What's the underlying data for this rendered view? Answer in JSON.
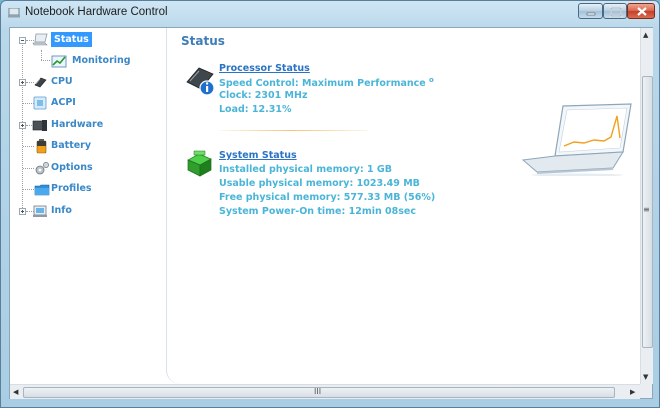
{
  "window": {
    "title": "Notebook Hardware Control",
    "controls": [
      "minimize",
      "maximize",
      "close"
    ]
  },
  "tree": {
    "items": [
      {
        "label": "Status",
        "icon": "notebook-icon",
        "selected": true,
        "expander": "minus"
      },
      {
        "label": "Monitoring",
        "icon": "chart-icon",
        "selected": false,
        "expander": "none"
      },
      {
        "label": "CPU",
        "icon": "cpu-icon",
        "selected": false,
        "expander": "plus"
      },
      {
        "label": "ACPI",
        "icon": "acpi-icon",
        "selected": false,
        "expander": "none"
      },
      {
        "label": "Hardware",
        "icon": "hardware-icon",
        "selected": false,
        "expander": "plus"
      },
      {
        "label": "Battery",
        "icon": "battery-icon",
        "selected": false,
        "expander": "none"
      },
      {
        "label": "Options",
        "icon": "gear-icon",
        "selected": false,
        "expander": "none"
      },
      {
        "label": "Profiles",
        "icon": "folder-icon",
        "selected": false,
        "expander": "none"
      },
      {
        "label": "Info",
        "icon": "info-icon",
        "selected": false,
        "expander": "plus"
      }
    ]
  },
  "content": {
    "title": "Status",
    "processor": {
      "heading": "Processor Status",
      "speed_control": "Speed Control:  Maximum Performance",
      "speed_marker": "o",
      "clock": "Clock:  2301 MHz",
      "load": "Load:  12.31%"
    },
    "system": {
      "heading": "System Status",
      "installed_memory": "Installed physical memory:  1 GB",
      "usable_memory": "Usable physical memory:  1023.49 MB",
      "free_memory": "Free physical memory:  577.33 MB  (56%)",
      "power_on_time": "System Power-On time:  12min  08sec"
    }
  },
  "scrollbars": {
    "vertical_grip": "≡",
    "horizontal_grip": "III"
  },
  "colors": {
    "accent": "#3399ff",
    "heading": "#3f7db7",
    "link": "#2a73c5",
    "value_text": "#4ab5d8"
  }
}
